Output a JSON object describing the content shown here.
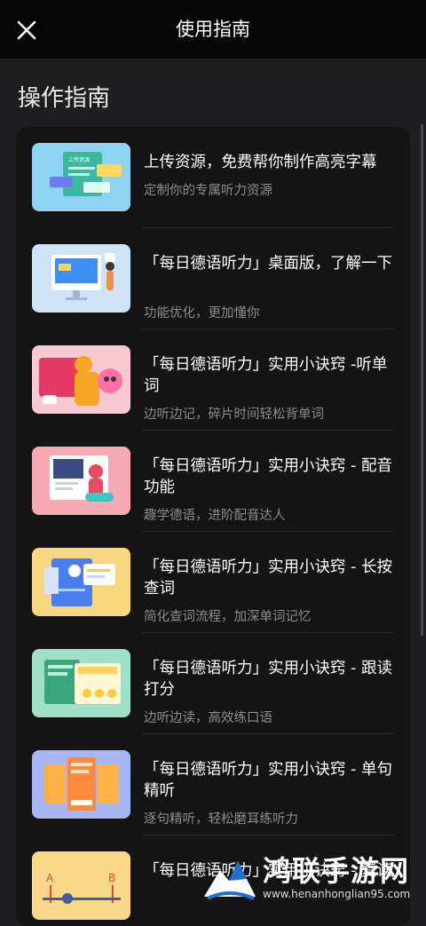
{
  "header": {
    "title": "使用指南",
    "close_icon": "close-icon"
  },
  "section": {
    "heading": "操作指南"
  },
  "items": [
    {
      "title": "上传资源，免费帮你制作高亮字幕",
      "subtitle": "定制你的专属听力资源",
      "thumb_bg": "#8fd3f2",
      "thumb_label": "上传资源"
    },
    {
      "title": "「每日德语听力」桌面版，了解一下",
      "subtitle": "功能优化，更加懂你",
      "thumb_bg": "#cfe3f7"
    },
    {
      "title": "「每日德语听力」实用小诀窍 -听单词",
      "subtitle": "边听边记，碎片时间轻松背单词",
      "thumb_bg": "#f6c9d3"
    },
    {
      "title": "「每日德语听力」实用小诀窍 - 配音功能",
      "subtitle": "趣学德语，进阶配音达人",
      "thumb_bg": "#f4a9b4"
    },
    {
      "title": "「每日德语听力」实用小诀窍 - 长按查词",
      "subtitle": "简化查词流程，加深单词记忆",
      "thumb_bg": "#f9d77e"
    },
    {
      "title": "「每日德语听力」实用小诀窍 - 跟读打分",
      "subtitle": "边听边读，高效练口语",
      "thumb_bg": "#9fe0c7"
    },
    {
      "title": "「每日德语听力」实用小诀窍 - 单句精听",
      "subtitle": "逐句精听，轻松磨耳练听力",
      "thumb_bg": "#a9b6f5"
    },
    {
      "title": "「每日德语听力」实用小诀窍 - 复读",
      "subtitle": "",
      "thumb_bg": "#f8d889",
      "thumb_label_a": "A",
      "thumb_label_b": "B"
    }
  ],
  "watermark": {
    "name": "鸿联手游网",
    "url": "www.henanhonglian95.com"
  }
}
